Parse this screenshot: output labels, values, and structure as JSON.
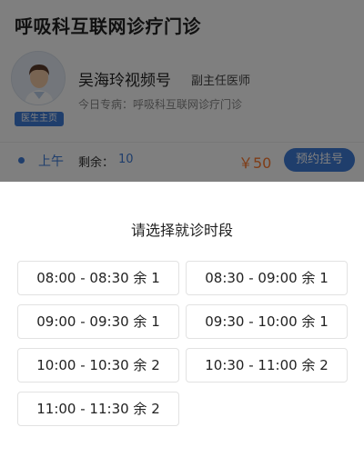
{
  "header": {
    "title": "呼吸科互联网诊疗门诊"
  },
  "doctor": {
    "name": "吴海玲视频号",
    "title": "副主任医师",
    "home_label": "医生主页",
    "today_label": "今日专病：",
    "today_value": "呼吸科互联网诊疗门诊"
  },
  "schedule": {
    "period": "上午",
    "remain_label": "剩余：",
    "remain_value": "10",
    "price": "￥50",
    "book_label": "预约挂号"
  },
  "sheet": {
    "title": "请选择就诊时段",
    "slots": [
      {
        "label": "08:00 - 08:30 余 1"
      },
      {
        "label": "08:30 - 09:00 余 1"
      },
      {
        "label": "09:00 - 09:30 余 1"
      },
      {
        "label": "09:30 - 10:00 余 1"
      },
      {
        "label": "10:00 - 10:30 余 2"
      },
      {
        "label": "10:30 - 11:00 余 2"
      },
      {
        "label": "11:00 - 11:30 余 2"
      }
    ]
  },
  "colors": {
    "accent": "#3f7cd9",
    "price": "#ff7a2f",
    "overlay": "rgba(0,0,0,0.5)"
  }
}
